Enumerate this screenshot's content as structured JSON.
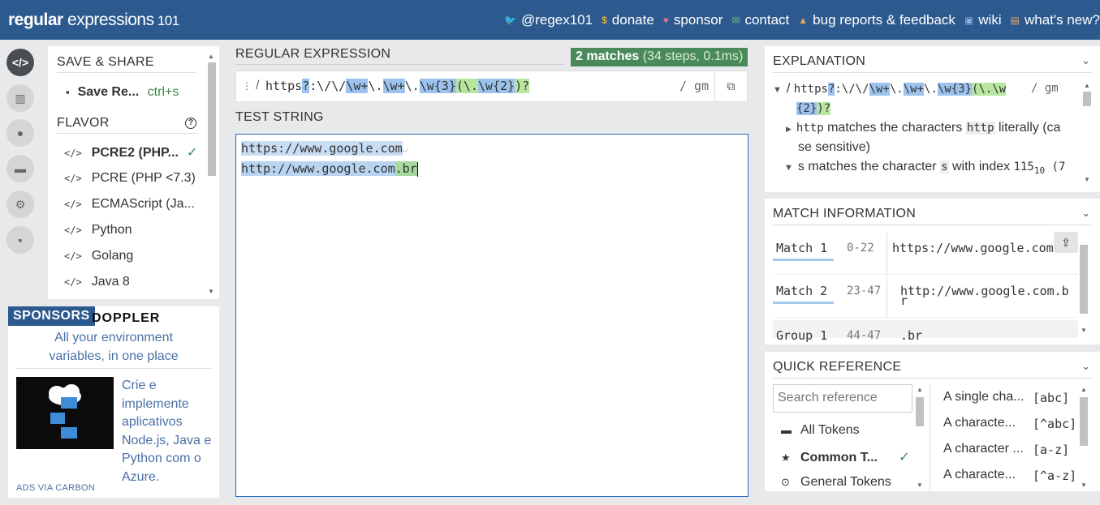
{
  "header": {
    "logo_regular": "regular",
    "logo_expressions": " expressions",
    "logo_num": " 101",
    "nav": [
      {
        "icon": "twitter-icon",
        "label": "@regex101"
      },
      {
        "icon": "dollar-icon",
        "label": "donate"
      },
      {
        "icon": "heart-icon",
        "label": "sponsor"
      },
      {
        "icon": "mail-icon",
        "label": "contact"
      },
      {
        "icon": "warning-icon",
        "label": "bug reports & feedback"
      },
      {
        "icon": "chat-icon",
        "label": "wiki"
      },
      {
        "icon": "news-icon",
        "label": "what's new?"
      }
    ]
  },
  "sidebar_icons": [
    "code-icon",
    "library-icon",
    "user-icon",
    "gamepad-icon",
    "settings-icon",
    "comments-icon"
  ],
  "save_share": {
    "title": "SAVE & SHARE",
    "save_label": "Save Re...",
    "shortcut": "ctrl+s"
  },
  "flavor": {
    "title": "FLAVOR",
    "items": [
      {
        "label": "PCRE2 (PHP...",
        "selected": true
      },
      {
        "label": "PCRE (PHP <7.3)",
        "selected": false
      },
      {
        "label": "ECMAScript (Ja...",
        "selected": false
      },
      {
        "label": "Python",
        "selected": false
      },
      {
        "label": "Golang",
        "selected": false
      },
      {
        "label": "Java 8",
        "selected": false
      }
    ]
  },
  "sponsors": {
    "tag": "SPONSORS",
    "name": "DOPPLER",
    "line1": "All your environment",
    "line2": "variables, in one place",
    "ad_text": "Crie e implemente aplicativos Node.js, Java e Python com o Azure.",
    "ads_via": "ADS VIA CARBON"
  },
  "regex": {
    "title": "REGULAR EXPRESSION",
    "match_count": "2 matches",
    "match_detail": " (34 steps, 0.1ms)",
    "delimiter": "/",
    "p1": "https",
    "p2": "?",
    "p3": ":\\/\\/",
    "p4": "\\w+",
    "p5": "\\.",
    "p6": "\\w+",
    "p7": "\\.",
    "p8": "\\w{3}",
    "p9": "(",
    "p10": "\\.",
    "p11": "\\w{2}",
    "p12": ")",
    "p13": "?",
    "flags": "/ gm"
  },
  "test_string": {
    "title": "TEST STRING",
    "line1": "https://www.google.com",
    "line2a": "http://www.google.com",
    "line2b": ".br"
  },
  "explanation": {
    "title": "EXPLANATION",
    "regex_line": "https?:\\/\\/\\w+\\.\\w+\\.\\w{3}(\\.\\w",
    "regex_line_b": "{2})?",
    "flags": "/ gm",
    "row1_token": "http",
    "row1_text": " matches the characters ",
    "row1_chip": "http",
    "row1_text2": " literally (ca",
    "row1_cont": "se sensitive)",
    "row2_token": "s",
    "row2_text": " matches the character ",
    "row2_chip": "s",
    "row2_text2": " with index ",
    "row2_num": "115",
    "row2_sub": "10",
    "row2_tail": " (7"
  },
  "match_info": {
    "title": "MATCH INFORMATION",
    "rows": [
      {
        "label": "Match 1",
        "range": "0-22",
        "value": "https://www.google.com"
      },
      {
        "label": "Match 2",
        "range": "23-47",
        "value": "http://www.google.com.b",
        "value2": "r"
      },
      {
        "label": "Group 1",
        "range": "44-47",
        "value": ".br"
      }
    ]
  },
  "quick_reference": {
    "title": "QUICK REFERENCE",
    "search_placeholder": "Search reference",
    "categories": [
      {
        "icon": "tokens-icon",
        "label": "All Tokens"
      },
      {
        "icon": "star-icon",
        "label": "Common T...",
        "selected": true
      },
      {
        "icon": "circle-dot-icon",
        "label": "General Tokens"
      }
    ],
    "items": [
      {
        "label": "A single cha...",
        "code": "[abc]"
      },
      {
        "label": "A characte...",
        "code": "[^abc]"
      },
      {
        "label": "A character ...",
        "code": "[a-z]"
      },
      {
        "label": "A characte...",
        "code": "[^a-z]"
      }
    ]
  },
  "colors": {
    "header_bg": "#2c5a8f",
    "match_badge": "#4a8a5a",
    "token_blue": "#9cc3ee",
    "group_green": "#b8e6a0"
  }
}
